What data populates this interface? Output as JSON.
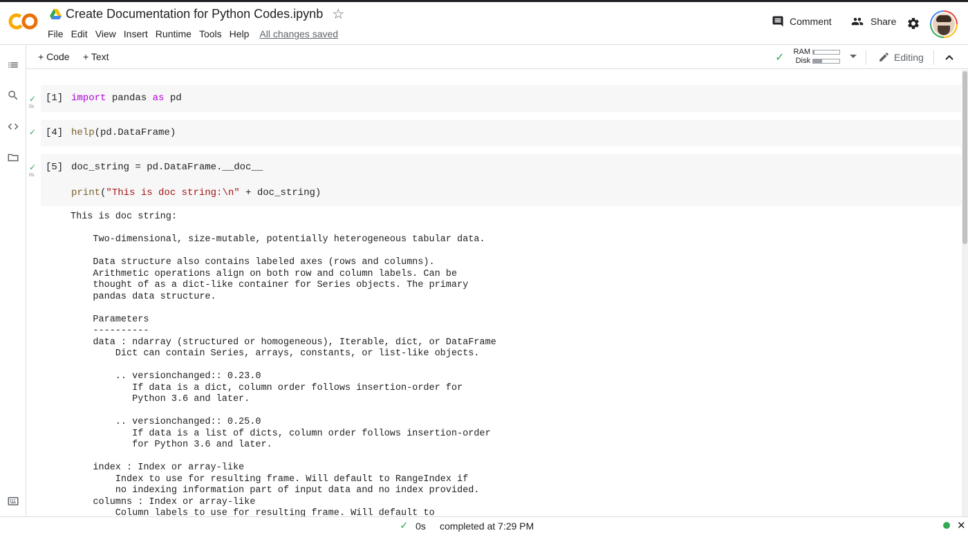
{
  "header": {
    "title": "Create Documentation for Python Codes.ipynb",
    "menu": [
      "File",
      "Edit",
      "View",
      "Insert",
      "Runtime",
      "Tools",
      "Help"
    ],
    "save_status": "All changes saved",
    "comment_label": "Comment",
    "share_label": "Share"
  },
  "toolbar": {
    "add_code": "+ Code",
    "add_text": "+ Text",
    "ram_label": "RAM",
    "disk_label": "Disk",
    "ram_fraction": 0.05,
    "disk_fraction": 0.35,
    "editing_label": "Editing"
  },
  "cells": [
    {
      "exec": "[1]",
      "time": "0s"
    },
    {
      "exec": "[4]"
    },
    {
      "exec": "[5]",
      "time": "0s"
    }
  ],
  "code": {
    "c1_kw1": "import",
    "c1_mid": " pandas ",
    "c1_kw2": "as",
    "c1_end": " pd",
    "c2_fn": "help",
    "c2_rest": "(pd.DataFrame)",
    "c3_line1": "doc_string = pd.DataFrame.__doc__",
    "c3_fn": "print",
    "c3_open": "(",
    "c3_str": "\"This is doc string:\\n\"",
    "c3_rest": " + doc_string)"
  },
  "output": "This is doc string:\n\n    Two-dimensional, size-mutable, potentially heterogeneous tabular data.\n\n    Data structure also contains labeled axes (rows and columns).\n    Arithmetic operations align on both row and column labels. Can be\n    thought of as a dict-like container for Series objects. The primary\n    pandas data structure.\n\n    Parameters\n    ----------\n    data : ndarray (structured or homogeneous), Iterable, dict, or DataFrame\n        Dict can contain Series, arrays, constants, or list-like objects.\n\n        .. versionchanged:: 0.23.0\n           If data is a dict, column order follows insertion-order for\n           Python 3.6 and later.\n\n        .. versionchanged:: 0.25.0\n           If data is a list of dicts, column order follows insertion-order\n           for Python 3.6 and later.\n\n    index : Index or array-like\n        Index to use for resulting frame. Will default to RangeIndex if\n        no indexing information part of input data and no index provided.\n    columns : Index or array-like\n        Column labels to use for resulting frame. Will default to",
  "status": {
    "time": "0s",
    "completed": "completed at 7:29 PM"
  },
  "colors": {
    "accent_green": "#34a853",
    "keyword": "#af00db",
    "function": "#795e26",
    "string": "#a31515",
    "logo_orange": "#f9ab00"
  }
}
